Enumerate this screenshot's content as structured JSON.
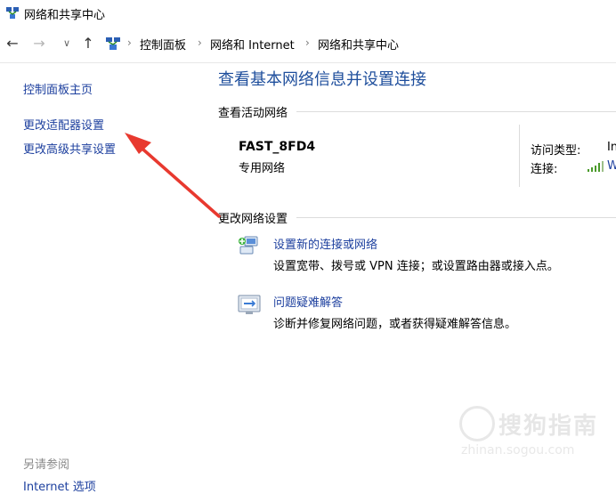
{
  "window": {
    "title": "网络和共享中心"
  },
  "address": {
    "breadcrumbs": [
      "控制面板",
      "网络和 Internet",
      "网络和共享中心"
    ]
  },
  "sidebar": {
    "home": "控制面板主页",
    "links": [
      "更改适配器设置",
      "更改高级共享设置"
    ],
    "see_also_title": "另请参阅",
    "see_also_items": [
      "Internet 选项"
    ]
  },
  "main": {
    "heading": "查看基本网络信息并设置连接",
    "active_networks_title": "查看活动网络",
    "network": {
      "name": "FAST_8FD4",
      "type": "专用网络",
      "access_type_label": "访问类型:",
      "access_type_value": "In",
      "connection_label": "连接:",
      "connection_value": "W"
    },
    "change_settings_title": "更改网络设置",
    "tasks": [
      {
        "link": "设置新的连接或网络",
        "desc": "设置宽带、拨号或 VPN 连接；或设置路由器或接入点。",
        "icon": "new-connection-icon"
      },
      {
        "link": "问题疑难解答",
        "desc": "诊断并修复网络问题，或者获得疑难解答信息。",
        "icon": "troubleshoot-icon"
      }
    ]
  },
  "watermark": {
    "text": "搜狗指南",
    "sub": "zhinan.sogou.com"
  },
  "colors": {
    "link": "#1c3f9e",
    "heading": "#1e4e9c",
    "arrow": "#e8392f"
  }
}
